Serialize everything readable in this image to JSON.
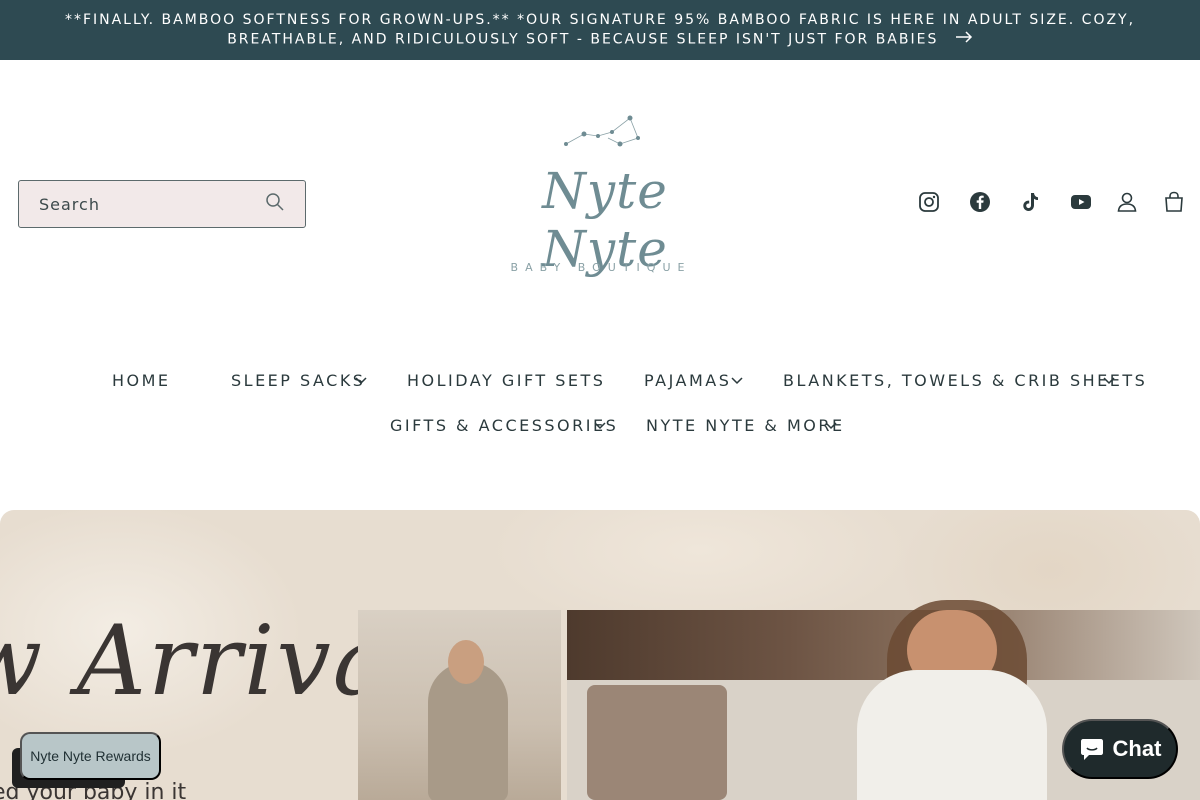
{
  "announcement": {
    "text": "**FINALLY. BAMBOO SOFTNESS FOR GROWN-UPS.** *OUR SIGNATURE 95% BAMBOO FABRIC IS HERE IN ADULT SIZE. COZY, BREATHABLE, AND RIDICULOUSLY SOFT - BECAUSE SLEEP ISN'T JUST FOR BABIES",
    "arrow": "→"
  },
  "header": {
    "search_label": "Search",
    "logo_text": "Nyte Nyte",
    "logo_subtitle": "BABY BOUTIQUE",
    "social_icons": [
      "instagram-icon",
      "facebook-icon",
      "tiktok-icon",
      "youtube-icon"
    ],
    "account_icon": "account-icon",
    "cart_icon": "cart-icon"
  },
  "nav": {
    "items": [
      {
        "label": "HOME",
        "dropdown": false
      },
      {
        "label": "SLEEP SACKS",
        "dropdown": true
      },
      {
        "label": "HOLIDAY GIFT SETS",
        "dropdown": false
      },
      {
        "label": "PAJAMAS",
        "dropdown": true
      },
      {
        "label": "BLANKETS, TOWELS & CRIB SHEETS",
        "dropdown": true
      },
      {
        "label": "GIFTS & ACCESSORIES",
        "dropdown": true
      },
      {
        "label": "NYTE NYTE & MORE",
        "dropdown": true
      }
    ]
  },
  "hero": {
    "script_text": "w Arrival",
    "tagline": "ed your baby in it"
  },
  "widgets": {
    "rewards_label": "Nyte Nyte Rewards",
    "chat_label": "Chat"
  },
  "colors": {
    "announcement_bg": "#2e4a52",
    "search_bg": "#f2e9e9",
    "logo": "#6f8c93",
    "chat_bg": "#1f2a2c",
    "rewards_bg": "#b8c6c8"
  }
}
